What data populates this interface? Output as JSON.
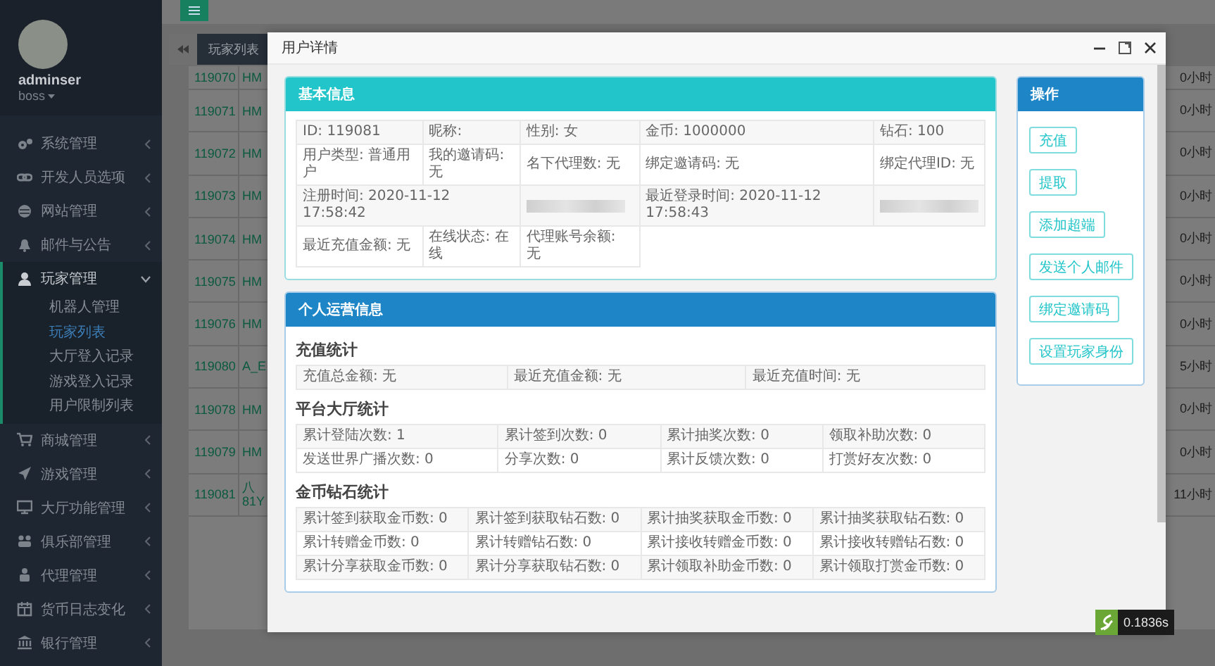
{
  "sidebar": {
    "user": {
      "name": "adminser",
      "role": "boss"
    },
    "items": [
      {
        "label": "系统管理",
        "expanded": false
      },
      {
        "label": "开发人员选项",
        "expanded": false
      },
      {
        "label": "网站管理",
        "expanded": false
      },
      {
        "label": "邮件与公告",
        "expanded": false
      },
      {
        "label": "玩家管理",
        "expanded": true,
        "children": [
          {
            "label": "机器人管理",
            "selected": false
          },
          {
            "label": "玩家列表",
            "selected": true
          },
          {
            "label": "大厅登入记录",
            "selected": false
          },
          {
            "label": "游戏登入记录",
            "selected": false
          },
          {
            "label": "用户限制列表",
            "selected": false
          }
        ]
      },
      {
        "label": "商城管理",
        "expanded": false
      },
      {
        "label": "游戏管理",
        "expanded": false
      },
      {
        "label": "大厅功能管理",
        "expanded": false
      },
      {
        "label": "俱乐部管理",
        "expanded": false
      },
      {
        "label": "代理管理",
        "expanded": false
      },
      {
        "label": "货币日志变化",
        "expanded": false
      },
      {
        "label": "银行管理",
        "expanded": false
      }
    ]
  },
  "tabs": [
    {
      "label": "玩家列表",
      "selected": true
    }
  ],
  "player_table": {
    "rows": [
      {
        "id": "119070",
        "column_2": "HM",
        "column_3": "0小时"
      },
      {
        "id": "119071",
        "column_2": "HM",
        "column_3": "0小时"
      },
      {
        "id": "119072",
        "column_2": "HM",
        "column_3": "0小时"
      },
      {
        "id": "119073",
        "column_2": "HM",
        "column_3": "0小时"
      },
      {
        "id": "119074",
        "column_2": "HM",
        "column_3": "0小时"
      },
      {
        "id": "119075",
        "column_2": "HM",
        "column_3": "0小时"
      },
      {
        "id": "119076",
        "column_2": "HM",
        "column_3": "0小时"
      },
      {
        "id": "119080",
        "column_2": "A_E",
        "column_3": "5小时"
      },
      {
        "id": "119078",
        "column_2": "HM",
        "column_3": "0小时"
      },
      {
        "id": "119079",
        "column_2": "HM",
        "column_3": "0小时"
      },
      {
        "id": "119081",
        "column_2": "八 81Y",
        "column_3": "11小时"
      }
    ]
  },
  "modal": {
    "title": "用户详情",
    "basic_info": {
      "title": "基本信息",
      "rows": [
        [
          {
            "kind": "text",
            "text": "ID: 119081"
          },
          {
            "kind": "text",
            "text": "昵称:"
          },
          {
            "kind": "text",
            "text": "性别: 女"
          },
          {
            "kind": "text",
            "text": "金币: 1000000"
          },
          {
            "kind": "text",
            "text": "钻石: 100"
          }
        ],
        [
          {
            "kind": "text",
            "text": "用户类型: 普通用户"
          },
          {
            "kind": "text",
            "text": "我的邀请码: 无"
          },
          {
            "kind": "text",
            "text": "名下代理数: 无"
          },
          {
            "kind": "text",
            "text": "绑定邀请码: 无"
          },
          {
            "kind": "text",
            "text": "绑定代理ID: 无"
          }
        ],
        [
          {
            "kind": "text",
            "colspan": 2,
            "text": "注册时间: 2020-11-12 17:58:42"
          },
          {
            "kind": "redacted"
          },
          {
            "kind": "text",
            "text": "最近登录时间: 2020-11-12 17:58:43"
          },
          {
            "kind": "redacted"
          }
        ],
        [
          {
            "kind": "text",
            "text": "最近充值金额: 无"
          },
          {
            "kind": "text",
            "text": "在线状态: 在线"
          },
          {
            "kind": "text",
            "text": "代理账号余额: 无"
          }
        ]
      ]
    },
    "operations": {
      "title": "个人运营信息",
      "sections": [
        {
          "title": "充值统计",
          "rows": [
            [
              "充值总金额: 无",
              "最近充值金额: 无",
              "最近充值时间: 无"
            ]
          ]
        },
        {
          "title": "平台大厅统计",
          "rows": [
            [
              "累计登陆次数: 1",
              "累计签到次数: 0",
              "累计抽奖次数: 0",
              "领取补助次数: 0"
            ],
            [
              "发送世界广播次数: 0",
              "分享次数: 0",
              "累计反馈次数: 0",
              "打赏好友次数: 0"
            ]
          ]
        },
        {
          "title": "金币钻石统计",
          "rows": [
            [
              "累计签到获取金币数: 0",
              "累计签到获取钻石数: 0",
              "累计抽奖获取金币数: 0",
              "累计抽奖获取钻石数: 0"
            ],
            [
              "累计转赠金币数: 0",
              "累计转赠钻石数: 0",
              "累计接收转赠金币数: 0",
              "累计接收转赠钻石数: 0"
            ],
            [
              "累计分享获取金币数: 0",
              "累计分享获取钻石数: 0",
              "累计领取补助金币数: 0",
              "累计领取打赏金币数: 0"
            ]
          ]
        }
      ]
    },
    "actions": {
      "title": "操作",
      "buttons": [
        "充值",
        "提取",
        "添加超端",
        "发送个人邮件",
        "绑定邀请码",
        "设置玩家身份"
      ]
    }
  },
  "timer": {
    "text": "0.1836s"
  }
}
